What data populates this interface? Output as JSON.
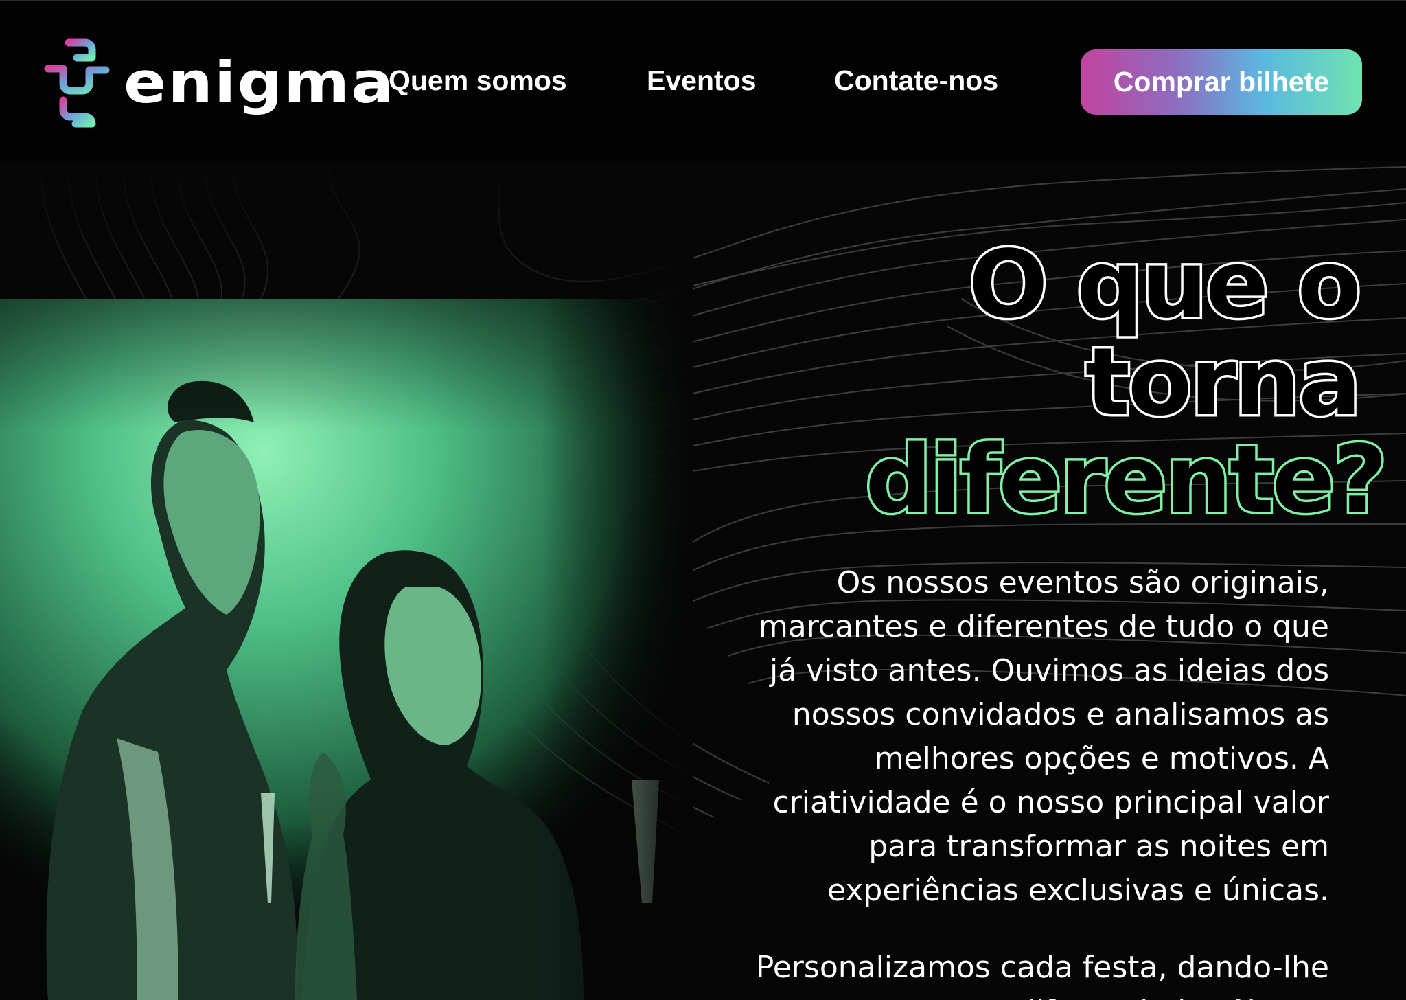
{
  "header": {
    "logo_text": "enigma",
    "nav": [
      {
        "label": "Quem somos"
      },
      {
        "label": "Eventos"
      },
      {
        "label": "Contate-nos"
      }
    ],
    "cta_label": "Comprar bilhete"
  },
  "hero": {
    "headline_line1": "O que o",
    "headline_line2": "torna",
    "headline_line3": "diferente?",
    "paragraph1": "Os nossos eventos são originais, marcantes e diferentes de tudo o que já visto antes. Ouvimos as ideias dos nossos convidados e analisamos as melhores opções e motivos. A criatividade é o nosso principal valor para transformar as noites em experiências exclusivas e únicas.",
    "paragraph2": "Personalizamos cada festa, dando-lhe um toque diferenciador. Nunca"
  },
  "colors": {
    "background": "#000000",
    "accent_green": "#7ff0a4",
    "cta_gradient": [
      "#c2439f",
      "#5bb8e0",
      "#6fe3b0"
    ]
  },
  "icons": [
    "enigma-logo-icon"
  ]
}
